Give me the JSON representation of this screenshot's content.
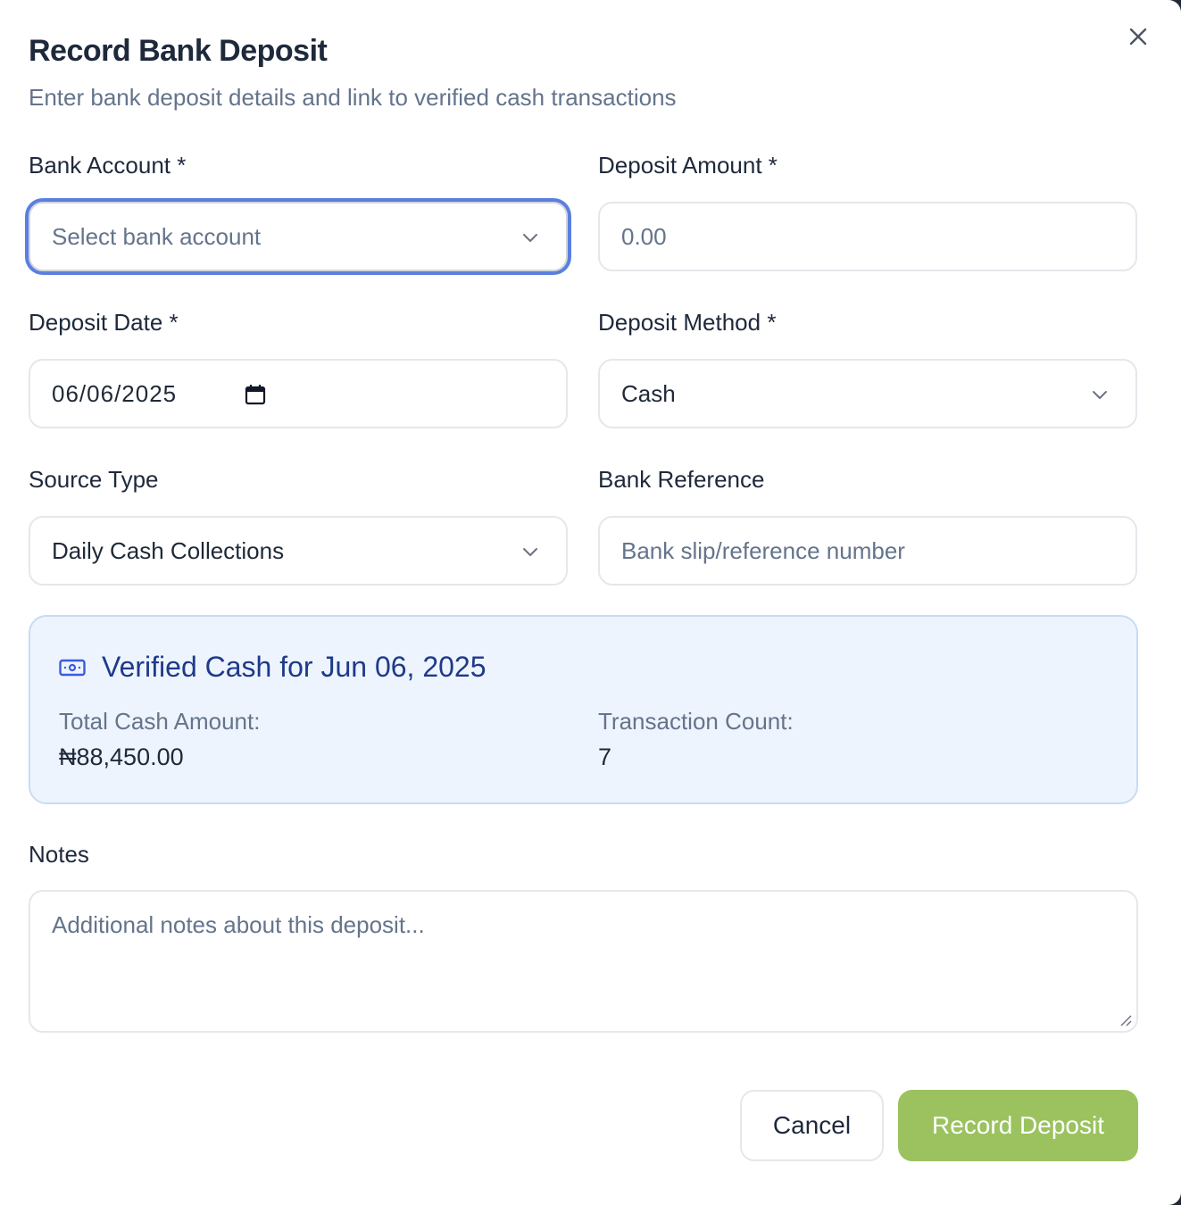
{
  "dialog": {
    "title": "Record Bank Deposit",
    "subtitle": "Enter bank deposit details and link to verified cash transactions",
    "close_icon": "close-icon"
  },
  "form": {
    "bank_account": {
      "label": "Bank Account *",
      "placeholder": "Select bank account",
      "value": ""
    },
    "deposit_amount": {
      "label": "Deposit Amount *",
      "placeholder": "0.00",
      "value": ""
    },
    "deposit_date": {
      "label": "Deposit Date *",
      "value": "06/06/2025"
    },
    "deposit_method": {
      "label": "Deposit Method *",
      "value": "Cash"
    },
    "source_type": {
      "label": "Source Type",
      "value": "Daily Cash Collections"
    },
    "bank_reference": {
      "label": "Bank Reference",
      "placeholder": "Bank slip/reference number",
      "value": ""
    },
    "notes": {
      "label": "Notes",
      "placeholder": "Additional notes about this deposit..."
    }
  },
  "verified_cash": {
    "title": "Verified Cash for Jun 06, 2025",
    "icon": "banknote-icon",
    "total_label": "Total Cash Amount:",
    "total_value": "₦88,450.00",
    "count_label": "Transaction Count:",
    "count_value": "7"
  },
  "actions": {
    "cancel_label": "Cancel",
    "submit_label": "Record Deposit"
  },
  "colors": {
    "accent_focus": "#5b7fe0",
    "primary_button": "#9bc25f",
    "info_panel_bg": "#eef4fd",
    "info_title": "#1e3a8a"
  }
}
